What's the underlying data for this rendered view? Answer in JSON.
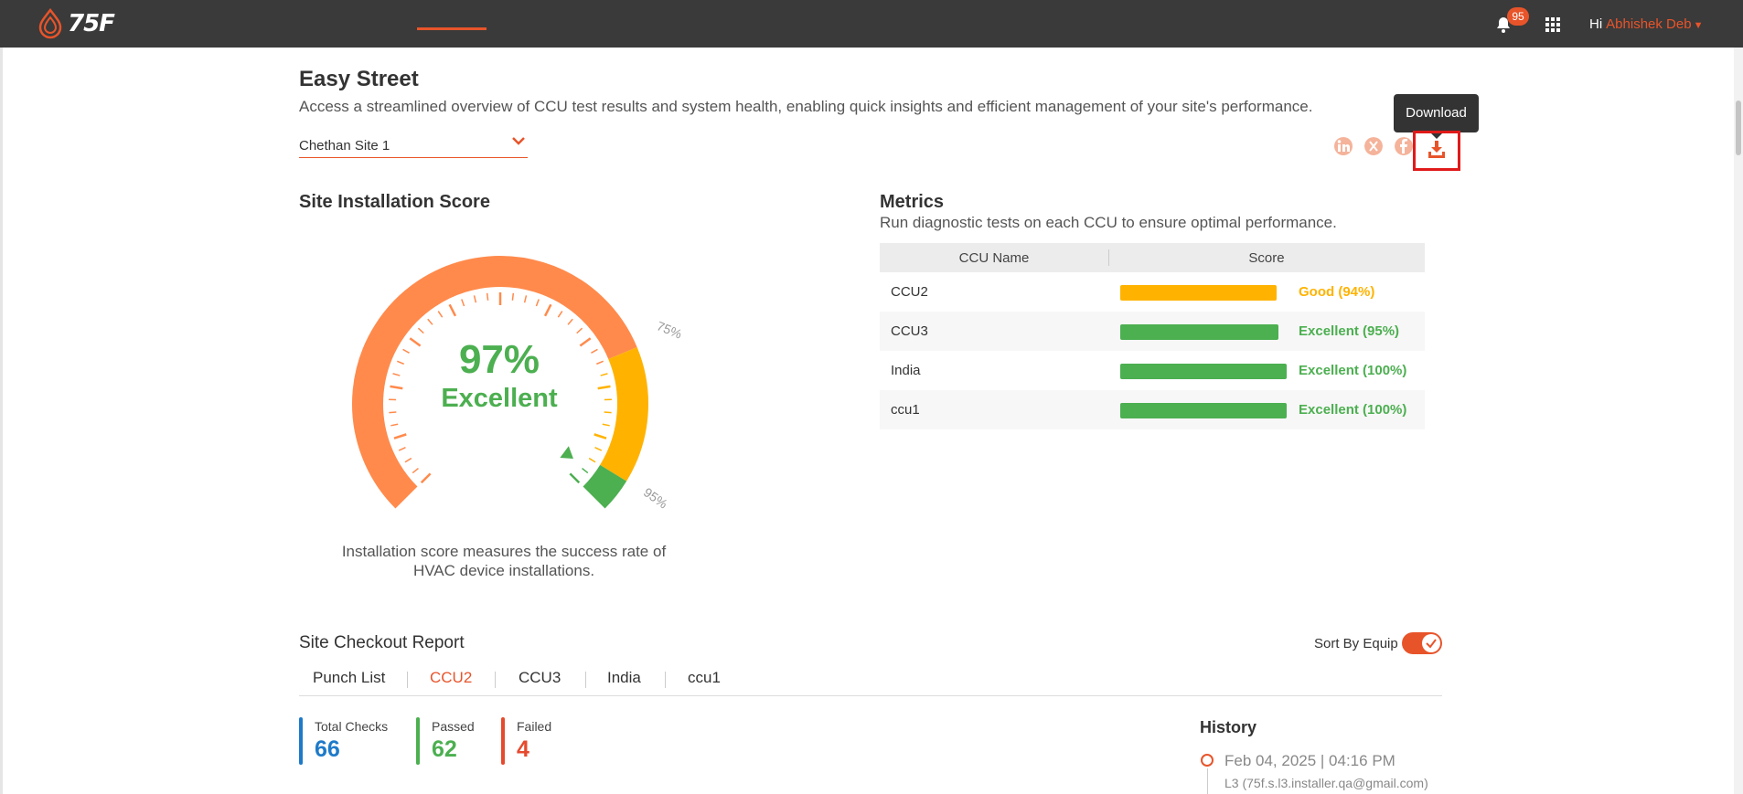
{
  "topbar": {
    "logo_text": "75F",
    "notification_count": "95",
    "greeting": "Hi",
    "user_name": "Abhishek Deb"
  },
  "header": {
    "title": "Easy Street",
    "subtitle": "Access a streamlined overview of CCU test results and system health, enabling quick insights and efficient management of your site's performance.",
    "site_select": "Chethan Site 1",
    "tooltip": "Download"
  },
  "installation": {
    "title": "Site Installation Score",
    "score_percent": "97%",
    "score_label": "Excellent",
    "mark_75": "75%",
    "mark_95": "95%",
    "score_value": 97,
    "description": "Installation score measures the success rate of HVAC device installations."
  },
  "metrics": {
    "title": "Metrics",
    "subtitle": "Run diagnostic tests on each CCU to ensure optimal performance.",
    "col_name": "CCU Name",
    "col_score": "Score",
    "rows": [
      {
        "name": "CCU2",
        "status": "Good (94%)",
        "percent": 94,
        "color": "#ffb300"
      },
      {
        "name": "CCU3",
        "status": "Excellent (95%)",
        "percent": 95,
        "color": "#4caf50"
      },
      {
        "name": "India",
        "status": "Excellent (100%)",
        "percent": 100,
        "color": "#4caf50"
      },
      {
        "name": "ccu1",
        "status": "Excellent (100%)",
        "percent": 100,
        "color": "#4caf50"
      }
    ]
  },
  "checkout": {
    "title": "Site Checkout Report",
    "sort_label": "Sort By Equip",
    "tabs": [
      "Punch List",
      "CCU2",
      "CCU3",
      "India",
      "ccu1"
    ],
    "total_label": "Total Checks",
    "total_value": "66",
    "passed_label": "Passed",
    "passed_value": "62",
    "failed_label": "Failed",
    "failed_value": "4"
  },
  "history": {
    "title": "History",
    "date": "Feb 04, 2025 | 04:16 PM",
    "user": "L3 (75f.s.l3.installer.qa@gmail.com)"
  },
  "colors": {
    "accent": "#e8542a",
    "gauge_orange": "#ff8a4c",
    "gauge_yellow": "#ffb300",
    "gauge_green": "#4caf50"
  }
}
